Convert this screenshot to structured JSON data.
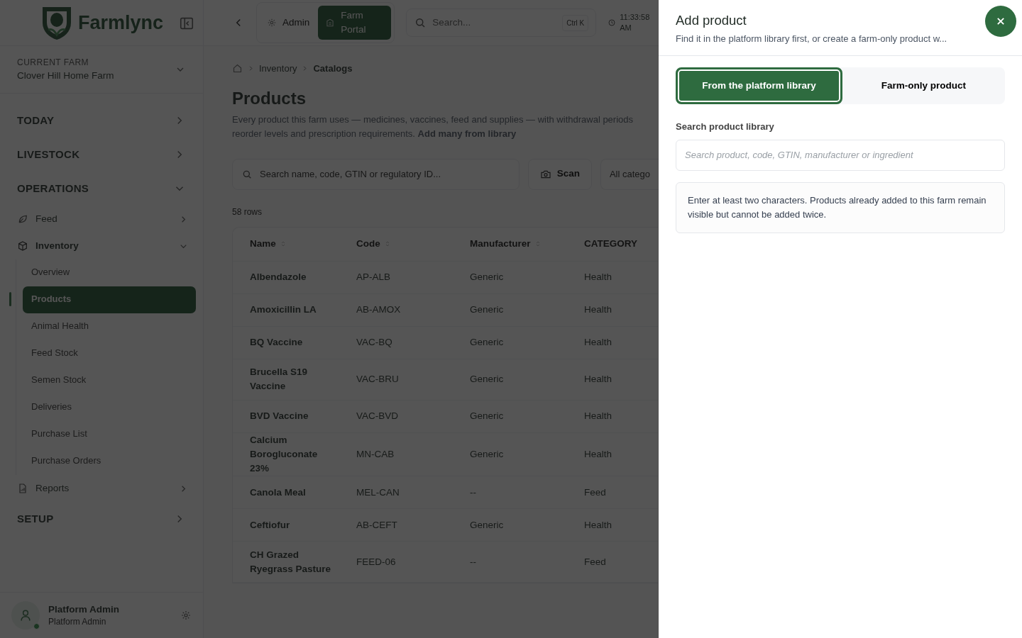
{
  "sidebar": {
    "logo_text": "Farmlync",
    "current_farm": {
      "label": "CURRENT FARM",
      "value": "Clover Hill Home Farm"
    },
    "sections": [
      {
        "label": "TODAY",
        "expanded": false
      },
      {
        "label": "LIVESTOCK",
        "expanded": false
      },
      {
        "label": "OPERATIONS",
        "expanded": true,
        "items": [
          {
            "label": "Feed",
            "expanded": false
          },
          {
            "label": "Inventory",
            "expanded": true,
            "children": [
              {
                "label": "Overview",
                "selected": false
              },
              {
                "label": "Products",
                "selected": true
              },
              {
                "label": "Animal Health",
                "selected": false
              },
              {
                "label": "Feed Stock",
                "selected": false
              },
              {
                "label": "Semen Stock",
                "selected": false
              },
              {
                "label": "Deliveries",
                "selected": false
              },
              {
                "label": "Purchase List",
                "selected": false
              },
              {
                "label": "Purchase Orders",
                "selected": false
              }
            ]
          },
          {
            "label": "Reports",
            "expanded": false
          }
        ]
      },
      {
        "label": "SETUP",
        "expanded": false
      }
    ],
    "user": {
      "name": "Platform Admin",
      "role": "Platform Admin",
      "online": true
    }
  },
  "topbar": {
    "portals": [
      {
        "label": "Admin",
        "selected": false
      },
      {
        "label": "Farm Portal",
        "selected": true
      }
    ],
    "search": {
      "placeholder": "Search...",
      "shortcut": "Ctrl K"
    },
    "time": "11:33:58 AM"
  },
  "breadcrumb": [
    "Inventory",
    "Catalogs"
  ],
  "page": {
    "title": "Products",
    "description": "Every product this farm uses — medicines, vaccines, feed and supplies — with withdrawal periods reorder levels and prescription requirements.",
    "link": "Add many from library"
  },
  "toolbar": {
    "search_placeholder": "Search name, code, GTIN or regulatory ID...",
    "scan": "Scan",
    "filter": "All catego"
  },
  "row_count": "58 rows",
  "table": {
    "columns": [
      {
        "label": "Name",
        "sortable": true
      },
      {
        "label": "Code",
        "sortable": true
      },
      {
        "label": "Manufacturer",
        "sortable": true
      },
      {
        "label": "CATEGORY",
        "sortable": false
      }
    ],
    "rows": [
      [
        "Albendazole",
        "AP-ALB",
        "Generic",
        "Health"
      ],
      [
        "Amoxicillin LA",
        "AB-AMOX",
        "Generic",
        "Health"
      ],
      [
        "BQ Vaccine",
        "VAC-BQ",
        "Generic",
        "Health"
      ],
      [
        "Brucella S19 Vaccine",
        "VAC-BRU",
        "Generic",
        "Health"
      ],
      [
        "BVD Vaccine",
        "VAC-BVD",
        "Generic",
        "Health"
      ],
      [
        "Calcium Borogluconate 23%",
        "MN-CAB",
        "Generic",
        "Health"
      ],
      [
        "Canola Meal",
        "MEL-CAN",
        "--",
        "Feed"
      ],
      [
        "Ceftiofur",
        "AB-CEFT",
        "Generic",
        "Health"
      ],
      [
        "CH Grazed Ryegrass Pasture",
        "FEED-06",
        "--",
        "Feed"
      ]
    ]
  },
  "drawer": {
    "title": "Add product",
    "subtitle": "Find it in the platform library first, or create a farm-only product w...",
    "modes": [
      {
        "label": "From the platform library",
        "selected": true
      },
      {
        "label": "Farm-only product",
        "selected": false
      }
    ],
    "search_label": "Search product library",
    "search_placeholder": "Search product, code, GTIN, manufacturer or ingredient",
    "hint": "Enter at least two characters. Products already added to this farm remain visible but cannot be added twice."
  }
}
